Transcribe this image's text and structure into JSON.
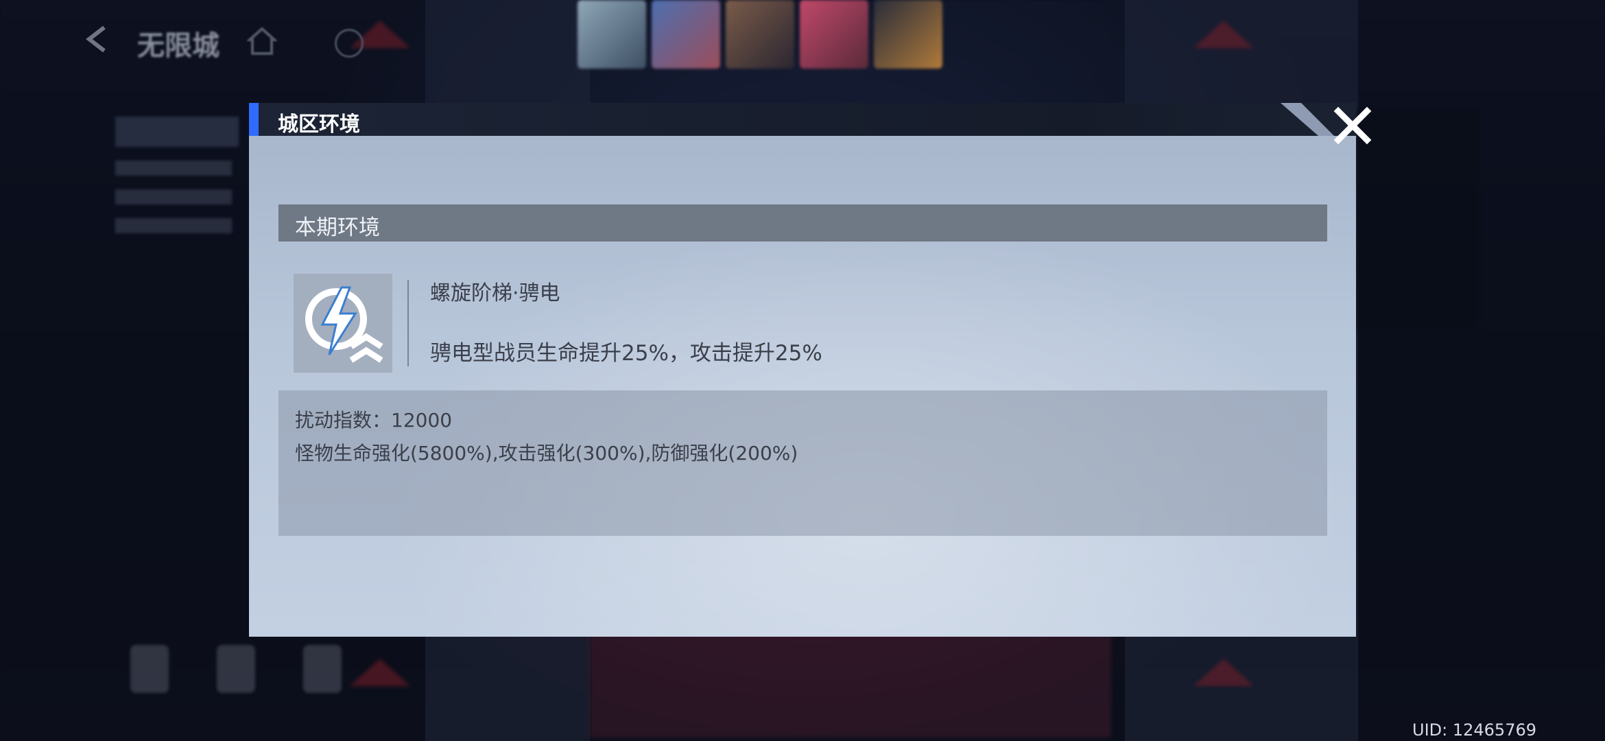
{
  "background": {
    "top_title": "无限城",
    "uid_label": "UID: 12465769"
  },
  "modal": {
    "title": "城区环境",
    "section_title": "本期环境",
    "environment": {
      "icon": "lightning-rank-up-icon",
      "name": "螺旋阶梯·骋电",
      "description": "骋电型战员生命提升25%，攻击提升25%"
    },
    "disturbance": {
      "index_line": "扰动指数：12000",
      "effects_line": "怪物生命强化(5800%),攻击强化(300%),防御强化(200%)"
    },
    "close_icon": "close-icon"
  },
  "colors": {
    "accent_blue": "#2f6bff",
    "header_dark": "#151b29",
    "section_gray": "#6f7885",
    "body_light": "#b8c6da",
    "text_dark": "#3a3f4a"
  }
}
